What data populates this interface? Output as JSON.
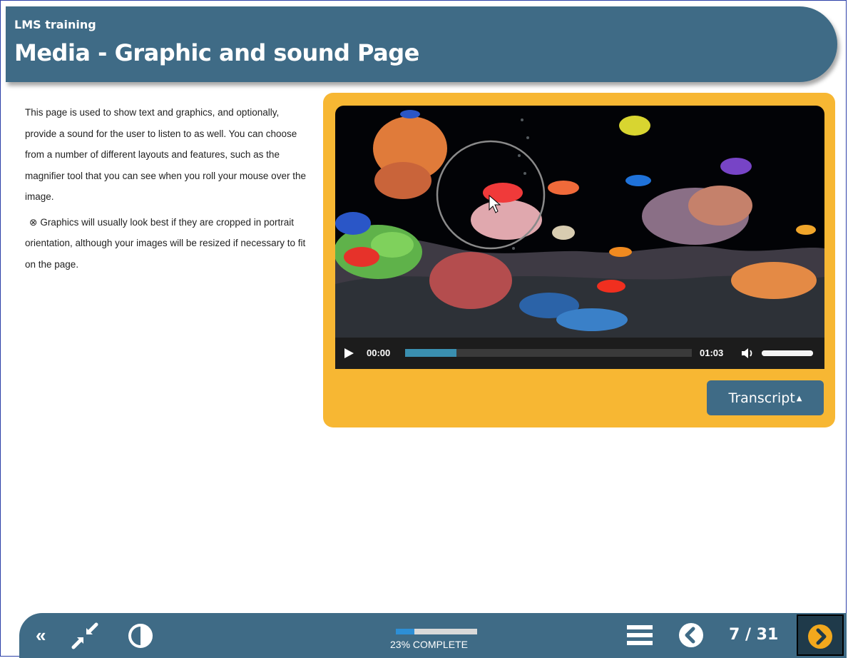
{
  "header": {
    "course_title": "LMS training",
    "page_title": "Media - Graphic and sound Page"
  },
  "content": {
    "paragraph1": "This page is used to show text and graphics, and optionally, provide a sound for the user to listen to as well. You can choose from a number of different layouts and features, such as the magnifier tool that you can see when you roll your mouse over the image.",
    "tip_icon": "⊗",
    "paragraph2": "Graphics will usually look best if they are cropped in portrait orientation, although your images will be resized if necessary to fit on the page."
  },
  "media": {
    "current_time": "00:00",
    "total_time": "01:03",
    "played_fraction": 0.18,
    "volume_fraction": 1.0,
    "transcript_label": "Transcript",
    "transcript_caret": "▲",
    "icons": [
      "play-icon",
      "volume-icon",
      "magnifier-lens"
    ]
  },
  "footer": {
    "back_label": "«",
    "progress_label": "23% COMPLETE",
    "progress_fraction": 0.23,
    "page_counter": "7 / 31",
    "icons": [
      "collapse-icon",
      "contrast-icon",
      "menu-icon",
      "prev-page-icon",
      "next-page-icon"
    ]
  },
  "colors": {
    "header_bg": "#3f6b86",
    "media_card_bg": "#f7b733",
    "accent_blue": "#2d8fd6",
    "next_button_icon": "#f2a81d"
  }
}
